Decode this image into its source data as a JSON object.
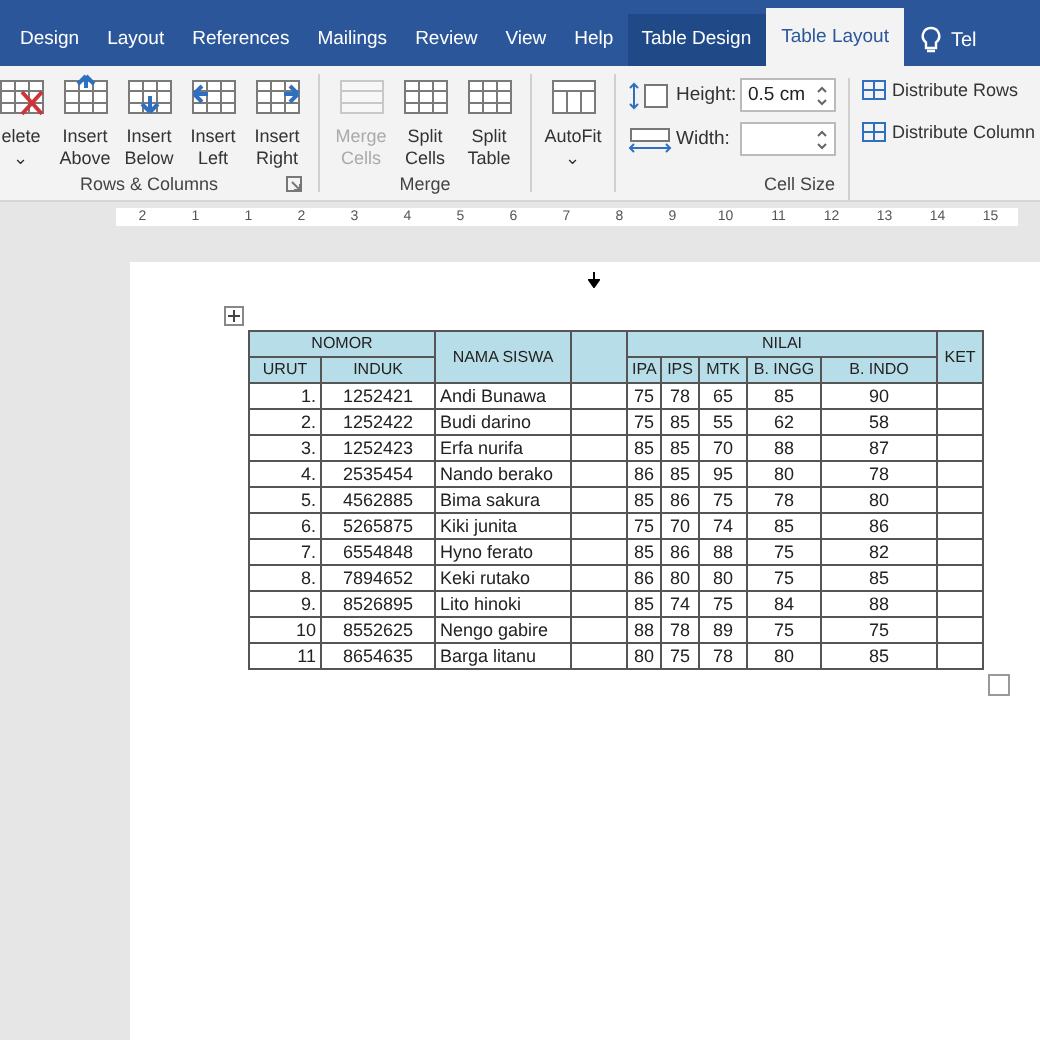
{
  "tabs": [
    {
      "label": "Design",
      "selected": false,
      "kind": "normal"
    },
    {
      "label": "Layout",
      "selected": false,
      "kind": "normal"
    },
    {
      "label": "References",
      "selected": false,
      "kind": "normal"
    },
    {
      "label": "Mailings",
      "selected": false,
      "kind": "normal"
    },
    {
      "label": "Review",
      "selected": false,
      "kind": "normal"
    },
    {
      "label": "View",
      "selected": false,
      "kind": "normal"
    },
    {
      "label": "Help",
      "selected": false,
      "kind": "normal"
    },
    {
      "label": "Table Design",
      "selected": false,
      "kind": "context"
    },
    {
      "label": "Table Layout",
      "selected": true,
      "kind": "context"
    },
    {
      "label": "Tel",
      "selected": false,
      "kind": "tell"
    }
  ],
  "ribbon": {
    "groups": [
      {
        "label": "Rows & Columns",
        "launcher": true,
        "buttons": [
          {
            "lines": [
              "elete",
              "⌄"
            ],
            "kind": "delete",
            "disabled": false
          },
          {
            "lines": [
              "Insert",
              "Above"
            ],
            "kind": "above",
            "disabled": false
          },
          {
            "lines": [
              "Insert",
              "Below"
            ],
            "kind": "below",
            "disabled": false
          },
          {
            "lines": [
              "Insert",
              "Left"
            ],
            "kind": "left",
            "disabled": false
          },
          {
            "lines": [
              "Insert",
              "Right"
            ],
            "kind": "right",
            "disabled": false
          }
        ]
      },
      {
        "label": "Merge",
        "buttons": [
          {
            "lines": [
              "Merge",
              "Cells"
            ],
            "kind": "merge",
            "disabled": true
          },
          {
            "lines": [
              "Split",
              "Cells"
            ],
            "kind": "split",
            "disabled": false
          },
          {
            "lines": [
              "Split",
              "Table"
            ],
            "kind": "splittable",
            "disabled": false
          }
        ]
      },
      {
        "buttons": [
          {
            "lines": [
              "AutoFit",
              "⌄"
            ],
            "kind": "autofit",
            "disabled": false
          }
        ]
      }
    ],
    "cell_size": {
      "label": "Cell Size",
      "height_label": "Height:",
      "height_value": "0.5 cm",
      "width_label": "Width:",
      "distribute": [
        "Distribute Rows",
        "Distribute Column"
      ]
    }
  },
  "ruler": {
    "labels": [
      "2",
      "1",
      "1",
      "2",
      "3",
      "4",
      "5",
      "6",
      "7",
      "8",
      "9",
      "10",
      "11",
      "12",
      "13",
      "14",
      "15"
    ]
  },
  "table": {
    "nomor": "NOMOR",
    "nomor_columns": [
      "URUT",
      "INDUK"
    ],
    "name_column": "NAMA SISWA",
    "nilai": "NILAI",
    "nilai_columns": [
      "IPA",
      "IPS",
      "MTK",
      "B. INGG",
      "B. INDO"
    ],
    "ket": "KET",
    "rows": [
      {
        "urut": "1.",
        "induk": "1252421",
        "nama": "Andi Bunawa",
        "nilai": [
          "75",
          "78",
          "65",
          "85",
          "90"
        ]
      },
      {
        "urut": "2.",
        "induk": "1252422",
        "nama": "Budi darino",
        "nilai": [
          "75",
          "85",
          "55",
          "62",
          "58"
        ]
      },
      {
        "urut": "3.",
        "induk": "1252423",
        "nama": "Erfa nurifa",
        "nilai": [
          "85",
          "85",
          "70",
          "88",
          "87"
        ]
      },
      {
        "urut": "4.",
        "induk": "2535454",
        "nama": "Nando berako",
        "nilai": [
          "86",
          "85",
          "95",
          "80",
          "78"
        ]
      },
      {
        "urut": "5.",
        "induk": "4562885",
        "nama": "Bima sakura",
        "nilai": [
          "85",
          "86",
          "75",
          "78",
          "80"
        ]
      },
      {
        "urut": "6.",
        "induk": "5265875",
        "nama": "Kiki junita",
        "nilai": [
          "75",
          "70",
          "74",
          "85",
          "86"
        ]
      },
      {
        "urut": "7.",
        "induk": "6554848",
        "nama": "Hyno ferato",
        "nilai": [
          "85",
          "86",
          "88",
          "75",
          "82"
        ]
      },
      {
        "urut": "8.",
        "induk": "7894652",
        "nama": "Keki rutako",
        "nilai": [
          "86",
          "80",
          "80",
          "75",
          "85"
        ]
      },
      {
        "urut": "9.",
        "induk": "8526895",
        "nama": "Lito hinoki",
        "nilai": [
          "85",
          "74",
          "75",
          "84",
          "88"
        ]
      },
      {
        "urut": "10",
        "induk": "8552625",
        "nama": "Nengo gabire",
        "nilai": [
          "88",
          "78",
          "89",
          "75",
          "75"
        ]
      },
      {
        "urut": "11",
        "induk": "8654635",
        "nama": "Barga litanu",
        "nilai": [
          "80",
          "75",
          "78",
          "80",
          "85"
        ]
      }
    ]
  }
}
